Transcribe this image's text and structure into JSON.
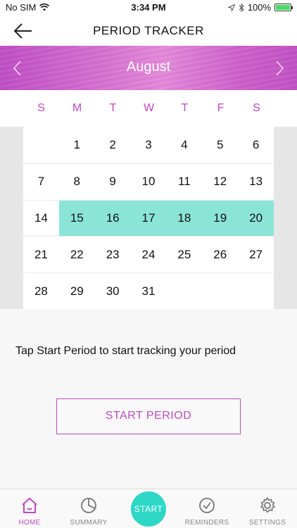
{
  "status_bar": {
    "carrier": "No SIM",
    "time": "3:34 PM",
    "battery": "100%",
    "battery_level": 1.0
  },
  "nav": {
    "title": "PERIOD TRACKER"
  },
  "calendar": {
    "month": "August",
    "weekdays": [
      "S",
      "M",
      "T",
      "W",
      "T",
      "F",
      "S"
    ],
    "weeks": [
      [
        "",
        "1",
        "2",
        "3",
        "4",
        "5",
        "6"
      ],
      [
        "7",
        "8",
        "9",
        "10",
        "11",
        "12",
        "13"
      ],
      [
        "14",
        "15",
        "16",
        "17",
        "18",
        "19",
        "20"
      ],
      [
        "21",
        "22",
        "23",
        "24",
        "25",
        "26",
        "27"
      ],
      [
        "28",
        "29",
        "30",
        "31",
        "",
        "",
        ""
      ]
    ],
    "highlighted_days": [
      "15",
      "16",
      "17",
      "18",
      "19",
      "20"
    ],
    "highlight_color": "#8be5d7"
  },
  "hint": "Tap Start Period to start tracking your period",
  "start_period_label": "START PERIOD",
  "tabs": [
    {
      "label": "HOME",
      "icon": "home-icon",
      "active": true
    },
    {
      "label": "SUMMARY",
      "icon": "pie-chart-icon",
      "active": false
    },
    {
      "label": "START",
      "icon": "start-button",
      "active": false
    },
    {
      "label": "REMINDERS",
      "icon": "check-circle-icon",
      "active": false
    },
    {
      "label": "SETTINGS",
      "icon": "gear-icon",
      "active": false
    }
  ],
  "colors": {
    "accent": "#c149c4",
    "teal": "#2ed8c7"
  }
}
